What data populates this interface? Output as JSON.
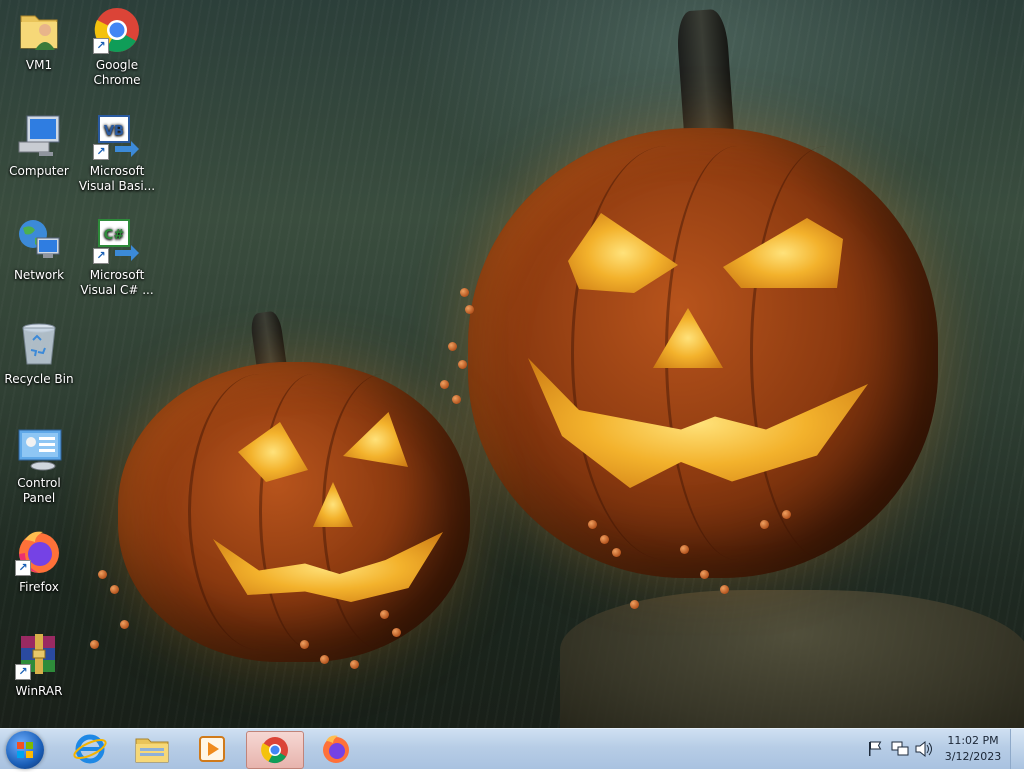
{
  "desktop": {
    "icons": [
      {
        "label": "VM1",
        "icon": "user-folder-icon",
        "shortcut": false
      },
      {
        "label": "Google Chrome",
        "icon": "chrome-icon",
        "shortcut": true
      },
      {
        "label": "Computer",
        "icon": "computer-icon",
        "shortcut": false
      },
      {
        "label": "Microsoft Visual Basi...",
        "icon": "visual-basic-icon",
        "shortcut": true
      },
      {
        "label": "Network",
        "icon": "network-icon",
        "shortcut": false
      },
      {
        "label": "Microsoft Visual C# ...",
        "icon": "visual-csharp-icon",
        "shortcut": true
      },
      {
        "label": "Recycle Bin",
        "icon": "recycle-bin-icon",
        "shortcut": false
      },
      {
        "label": "Control Panel",
        "icon": "control-panel-icon",
        "shortcut": false
      },
      {
        "label": "Firefox",
        "icon": "firefox-icon",
        "shortcut": true
      },
      {
        "label": "WinRAR",
        "icon": "winrar-icon",
        "shortcut": true
      }
    ],
    "vb_badge": "VB",
    "cs_badge": "C#",
    "wallpaper": "halloween-pumpkins"
  },
  "taskbar": {
    "start": "start-button",
    "pinned": [
      {
        "name": "internet-explorer",
        "icon": "internet-explorer-icon"
      },
      {
        "name": "windows-explorer",
        "icon": "folder-icon"
      },
      {
        "name": "media-player",
        "icon": "media-player-icon"
      },
      {
        "name": "google-chrome",
        "icon": "chrome-icon",
        "active": true
      },
      {
        "name": "firefox",
        "icon": "firefox-icon"
      }
    ],
    "tray": {
      "icons": [
        "action-center-flag-icon",
        "network-tray-icon",
        "volume-icon"
      ],
      "time": "11:02 PM",
      "date": "3/12/2023"
    },
    "colors": {
      "taskbar": "#b7cde6",
      "active_button": "#e7b4ad"
    }
  }
}
